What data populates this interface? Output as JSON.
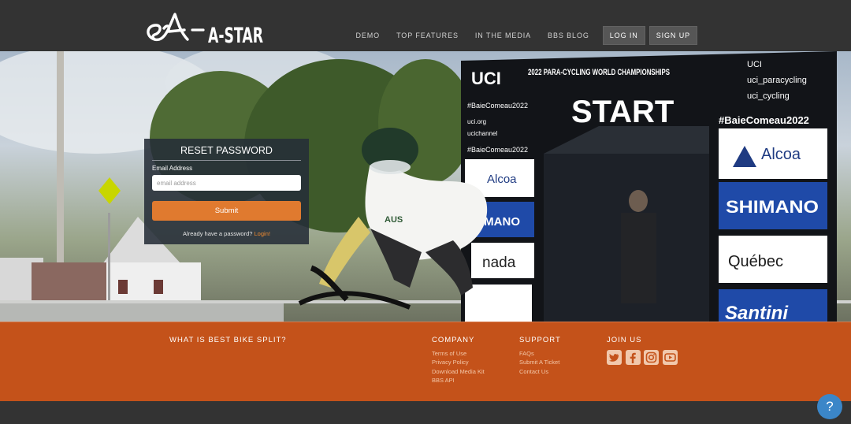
{
  "header": {
    "logo_text": "A-STAR",
    "nav": [
      "DEMO",
      "TOP FEATURES",
      "IN THE MEDIA",
      "BBS BLOG"
    ],
    "login_label": "LOG IN",
    "signup_label": "SIGN UP"
  },
  "hero": {
    "banner_title": "2022 PARA-CYCLING WORLD CHAMPIONSHIPS",
    "start_text": "START",
    "brand_uci": "UCI",
    "hashtag": "#BaieComeau2022",
    "social_handles": [
      "UCI",
      "uci_paracycling",
      "uci_cycling"
    ],
    "left_links": [
      "uci.org",
      "ucichannel"
    ],
    "sponsors_right": [
      "Alcoa",
      "SHIMANO",
      "Québec",
      "Santini"
    ],
    "sponsors_left": [
      "Alcoa",
      "IMANO",
      "nada"
    ],
    "jersey_text": "AUS"
  },
  "reset": {
    "title": "RESET PASSWORD",
    "email_label": "Email Address",
    "email_placeholder": "email address",
    "email_value": "",
    "submit_label": "Submit",
    "have_password_text": "Already have a password?",
    "login_link": "Login!"
  },
  "footer": {
    "about_heading": "WHAT IS BEST BIKE SPLIT?",
    "company_heading": "COMPANY",
    "company_links": [
      "Terms of Use",
      "Privacy Policy",
      "Download Media Kit",
      "BBS API"
    ],
    "support_heading": "SUPPORT",
    "support_links": [
      "FAQs",
      "Submit A Ticket",
      "Contact Us"
    ],
    "join_heading": "JOIN US",
    "social_icons": [
      "twitter-icon",
      "facebook-icon",
      "instagram-icon",
      "youtube-icon"
    ]
  },
  "help_label": "?",
  "colors": {
    "accent": "#e07a2f",
    "footer_bg": "#c4521a",
    "header_bg": "#333333",
    "help": "#3b86c8"
  }
}
